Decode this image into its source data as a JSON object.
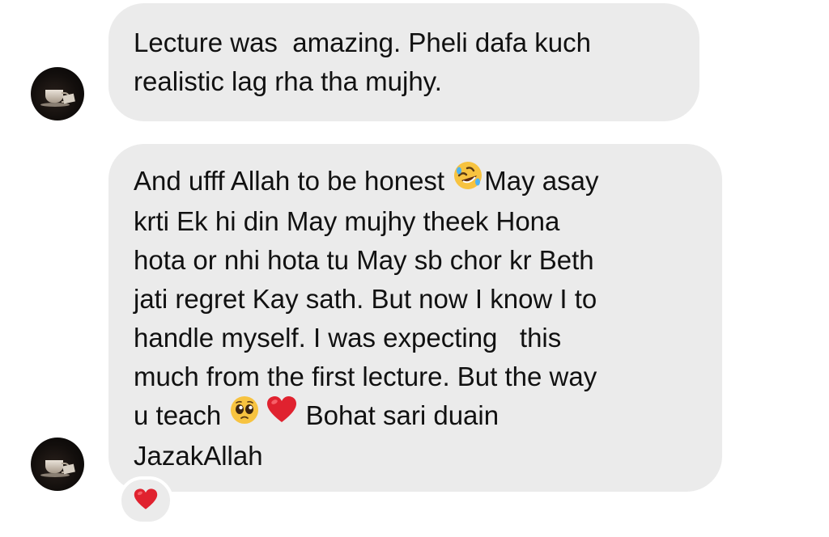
{
  "conversation": {
    "messages": [
      {
        "lines": [
          "Lecture was  amazing. Pheli dafa kuch",
          "realistic lag rha tha mujhy."
        ]
      },
      {
        "line1_before": "And ufff Allah to be honest ",
        "line1_emoji": "rolling-on-floor-laughing-emoji",
        "line1_after": "May asay",
        "lines_mid": [
          "krti Ek hi din May mujhy theek Hona",
          "hota or nhi hota tu May sb chor kr Beth",
          "jati regret Kay sath. But now I know I to",
          "handle myself. I was expecting   this",
          "much from the first lecture. But the way"
        ],
        "line8_before": "u teach ",
        "line8_emojis": [
          "pleading-face-emoji",
          "red-heart-emoji"
        ],
        "line8_after": " Bohat sari duain",
        "last_line": "JazakAllah",
        "reaction": "red-heart-emoji"
      }
    ]
  },
  "colors": {
    "bubble_background": "#ebebeb",
    "text": "#111111",
    "heart": "#e0222f",
    "emoji_yellow": "#f7c340"
  }
}
